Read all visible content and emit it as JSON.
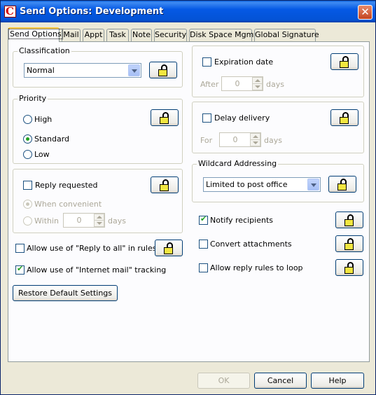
{
  "window": {
    "title": "Send Options:  Development",
    "close_glyph": "✕",
    "app_icon": "C"
  },
  "tabs": [
    {
      "label": "Send Options"
    },
    {
      "label": "Mail"
    },
    {
      "label": "Appt"
    },
    {
      "label": "Task"
    },
    {
      "label": "Note"
    },
    {
      "label": "Security"
    },
    {
      "label": "Disk Space Mgmt"
    },
    {
      "label": "Global Signature"
    }
  ],
  "active_tab": "Send Options",
  "classification": {
    "label": "Classification",
    "value": "Normal"
  },
  "priority": {
    "label": "Priority",
    "options": [
      "High",
      "Standard",
      "Low"
    ],
    "selected": "Standard"
  },
  "reply": {
    "checkbox_label": "Reply requested",
    "checked": false,
    "when_convenient": "When convenient",
    "within": "Within",
    "within_value": "0",
    "days": "days"
  },
  "reply_to_all": {
    "label": "Allow use of  \"Reply to all\" in rules",
    "checked": false
  },
  "internet_tracking": {
    "label": "Allow use of  \"Internet mail\" tracking",
    "checked": true
  },
  "restore_button": "Restore Default Settings",
  "expiration": {
    "label": "Expiration date",
    "checked": false,
    "after": "After",
    "value": "0",
    "days": "days"
  },
  "delay": {
    "label": "Delay delivery",
    "checked": false,
    "for": "For",
    "value": "0",
    "days": "days"
  },
  "wildcard": {
    "label": "Wildcard Addressing",
    "value": "Limited to post office"
  },
  "notify": {
    "label": "Notify recipients",
    "checked": true
  },
  "convert": {
    "label": "Convert attachments",
    "checked": false
  },
  "reply_loop": {
    "label": "Allow reply rules to loop",
    "checked": false
  },
  "buttons": {
    "ok": "OK",
    "cancel": "Cancel",
    "help": "Help"
  },
  "icons": {
    "lock": "padlock-unlocked-icon"
  },
  "colors": {
    "title_bar": "#0453d6",
    "lock_body": "#f2e640",
    "check_mark": "#21a121",
    "active_tab_accent": "#ffc83c"
  }
}
